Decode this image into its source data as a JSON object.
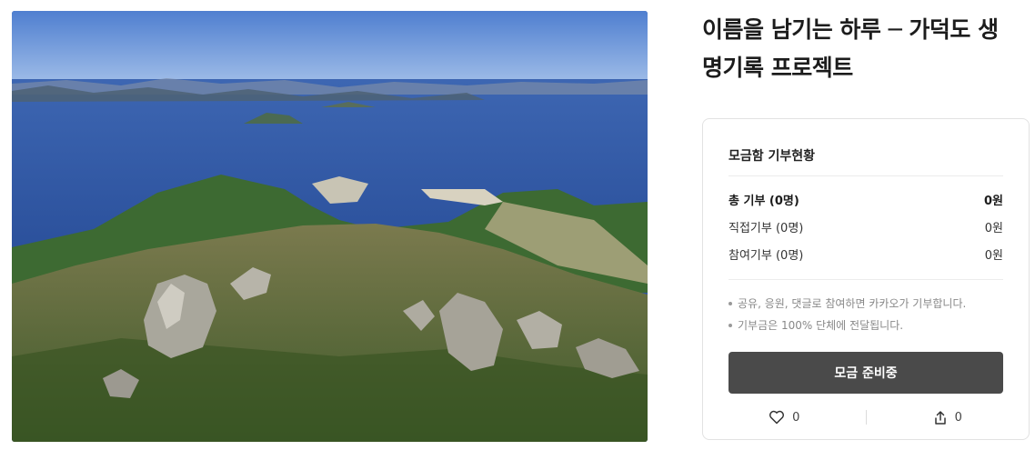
{
  "hero": {
    "image": "Aerial photo of Gadeokdo island peaks and sea"
  },
  "title": {
    "line1": "이름을 남기는 하루 ─ 가덕도 생",
    "line2": "명기록 프로젝트"
  },
  "donation": {
    "heading": "모금함 기부현황",
    "total_label": "총 기부 (0명)",
    "total_value": "0원",
    "direct_label": "직접기부 (0명)",
    "direct_value": "0원",
    "participation_label": "참여기부 (0명)",
    "participation_value": "0원",
    "notes": [
      "공유, 응원, 댓글로 참여하면 카카오가 기부합니다.",
      "기부금은 100% 단체에 전달됩니다."
    ],
    "button_label": "모금 준비중",
    "like_count": "0",
    "share_count": "0"
  },
  "icons": [
    "heart-icon",
    "share-icon"
  ],
  "colors": {
    "button_bg": "#4a4a4a",
    "heading": "#1c1c1c",
    "muted": "#888888"
  }
}
